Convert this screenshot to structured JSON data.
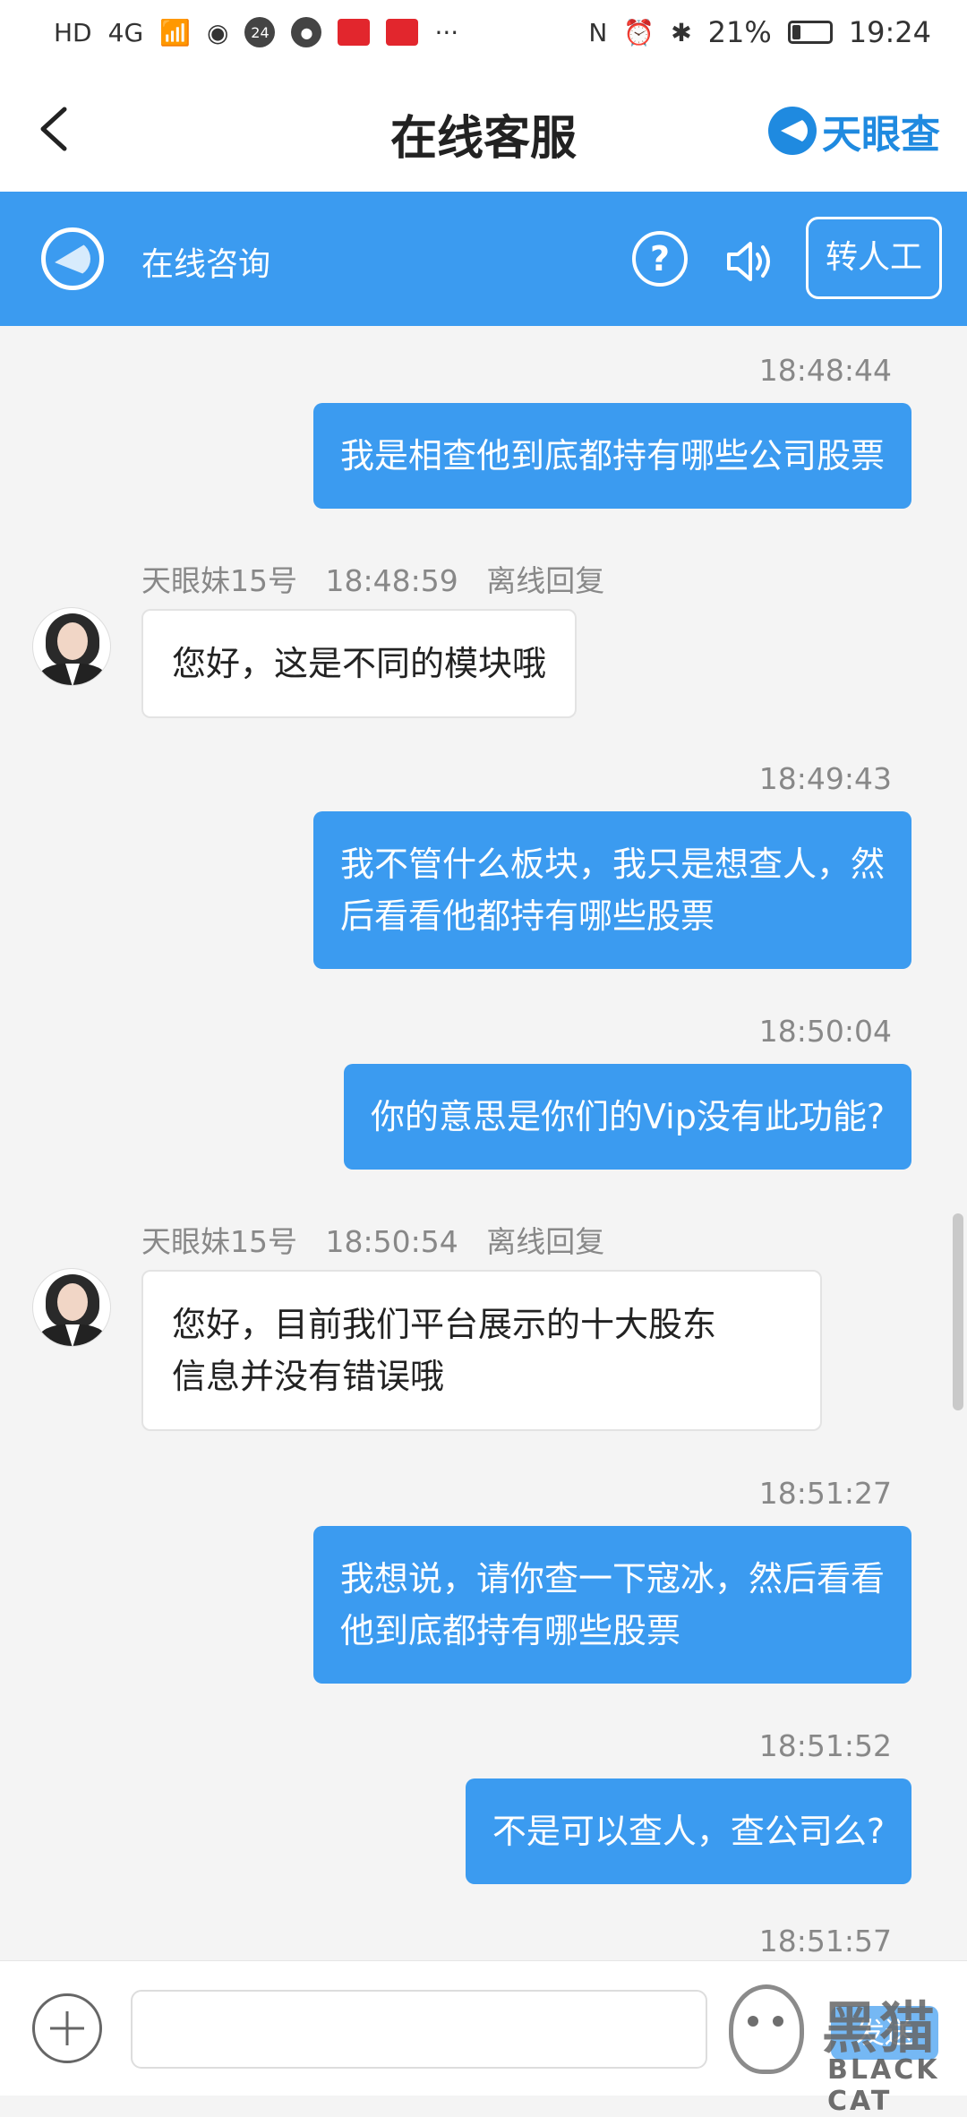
{
  "status_bar": {
    "left_labels": [
      "HD",
      "4G"
    ],
    "battery_percent": "21%",
    "time": "19:24",
    "more": "···"
  },
  "nav": {
    "title": "在线客服",
    "brand": "天眼查"
  },
  "service_bar": {
    "title": "在线咨询",
    "help": "?",
    "human_button": "转人工"
  },
  "messages": [
    {
      "type": "out",
      "time": "18:48:44",
      "text": "我是相查他到底都持有哪些公司股票"
    },
    {
      "type": "in",
      "agent": "天眼妹15号",
      "time": "18:48:59",
      "mode": "离线回复",
      "text": "您好，这是不同的模块哦"
    },
    {
      "type": "out",
      "time": "18:49:43",
      "line1": "我不管什么板块，我只是想查人，然",
      "line2": "后看看他都持有哪些股票"
    },
    {
      "type": "out",
      "time": "18:50:04",
      "text": "你的意思是你们的Vip没有此功能?"
    },
    {
      "type": "in",
      "agent": "天眼妹15号",
      "time": "18:50:54",
      "mode": "离线回复",
      "line1": "您好，目前我们平台展示的十大股东",
      "line2": "信息并没有错误哦"
    },
    {
      "type": "out",
      "time": "18:51:27",
      "line1": "我想说，请你查一下寇冰，然后看看",
      "line2": "他到底都持有哪些股票"
    },
    {
      "type": "out",
      "time": "18:51:52",
      "text": "不是可以查人，查公司么?"
    },
    {
      "type": "out",
      "time": "18:51:57"
    }
  ],
  "input_bar": {
    "placeholder": "",
    "send": "发送"
  },
  "watermark": {
    "cn": "黑猫",
    "en": "BLACK CAT"
  }
}
